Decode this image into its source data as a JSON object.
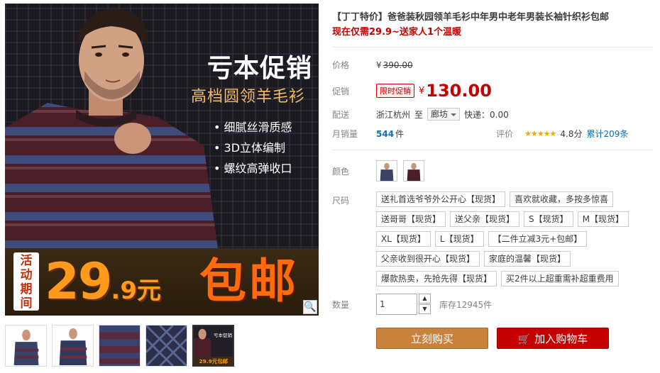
{
  "gallery": {
    "banner_title": "亏本促销",
    "banner_subtitle": "高档圆领羊毛衫",
    "features": [
      "细腻丝滑质感",
      "3D立体编制",
      "螺纹高弹收口"
    ],
    "promo_tag": [
      "活",
      "动",
      "期",
      "间"
    ],
    "promo_price_main": "29",
    "promo_price_small": ".9元",
    "promo_ship": "包邮",
    "zoom_icon": "magnifier-icon",
    "thumb_mini_title": "亏本促销",
    "thumb_mini_price": "29.9元包邮"
  },
  "product": {
    "title": "【丁丁特价】爸爸装秋园领羊毛衫中年男中老年男装长袖针织衫包邮",
    "subtitle": "现在仅需29.9~送家人1个温暖",
    "price_label": "价格",
    "original_yen": "¥",
    "original_price": "390.00",
    "promo_label": "促销",
    "promo_badge": "限时促销",
    "promo_yen": "¥",
    "promo_price": "130.00",
    "ship_label": "配送",
    "ship_from": "浙江杭州",
    "ship_to_word": "至",
    "ship_dest": "廊坊",
    "ship_fee": "快递：0.00",
    "sales_label": "月销量",
    "sales_num": "544",
    "sales_unit": "件",
    "rating_label": "评价",
    "stars": "★★★★★",
    "rating": "4.8分",
    "reviews": "累计209条",
    "color_label": "颜色",
    "size_label": "尺码",
    "sizes": [
      "送礼首选爷爷外公开心【现货】",
      "喜欢就收藏，多按多惊喜",
      "送哥哥【现货】",
      "送父亲【现货】",
      "S【现货】",
      "M【现货】",
      "XL【现货】",
      "L【现货】",
      "【二件立减3元+包邮】",
      "父亲收到很开心【现货】",
      "家庭的温馨【现货】",
      "爆款热卖，先抢先得【现货】",
      "买2件以上超重需补超重费用"
    ],
    "qty_label": "数量",
    "qty_value": "1",
    "stock": "库存12945件",
    "buy_button": "立刻购买",
    "cart_button": "加入购物车"
  },
  "colors": {
    "accent_red": "#c40000",
    "buy_btn": "#c9823c",
    "promo_orange": "#ff9a1c"
  }
}
